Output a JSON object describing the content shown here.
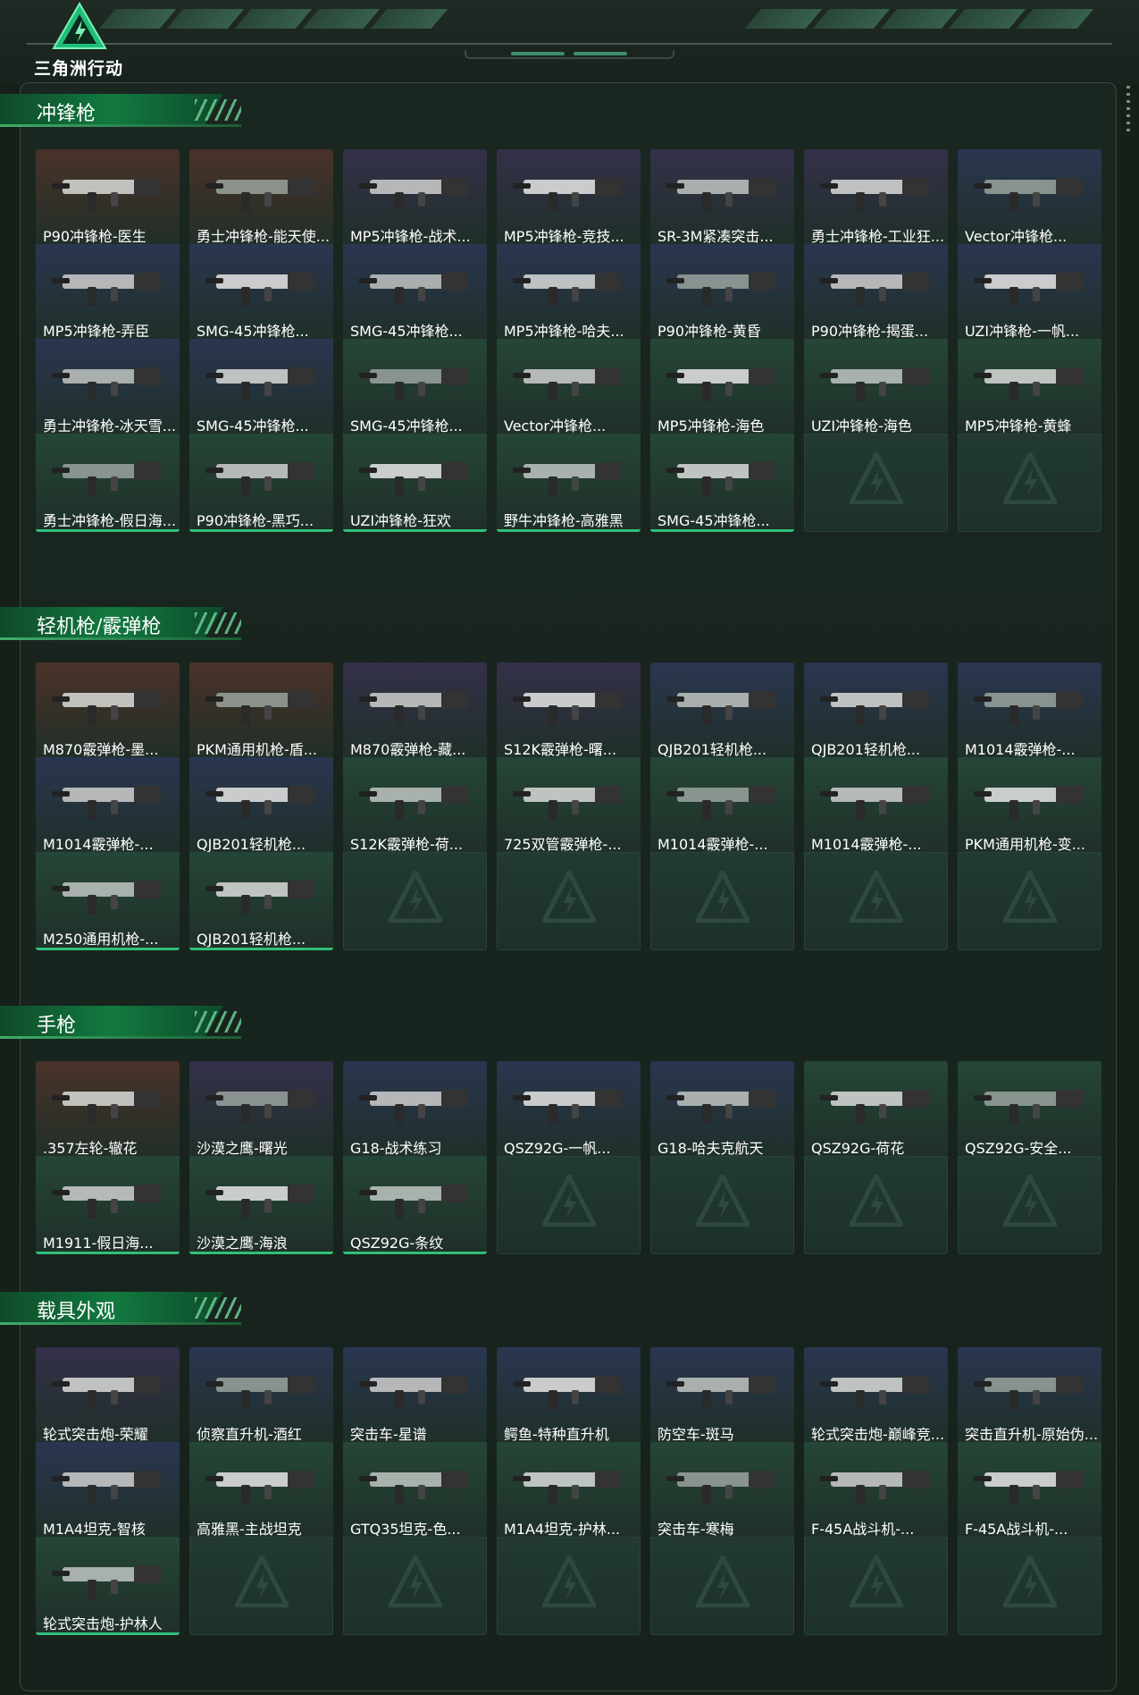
{
  "brand": {
    "logo_text": "三角洲行动"
  },
  "colors": {
    "orange": "#c96a22",
    "purple": "#7a3ed3",
    "blue": "#2d6fd6",
    "green": "#2fc07a",
    "gray": "#8a8f8c",
    "bg_orange": "#4a3229",
    "bg_purple": "#34304a",
    "bg_blue": "#2a3650",
    "bg_green": "#254636"
  },
  "sections": [
    {
      "title": "冲锋枪",
      "items": [
        {
          "name": "P90冲锋枪-医生",
          "rarity": "orange"
        },
        {
          "name": "勇士冲锋枪-能天使...",
          "rarity": "orange"
        },
        {
          "name": "MP5冲锋枪-战术...",
          "rarity": "purple"
        },
        {
          "name": "MP5冲锋枪-竞技...",
          "rarity": "purple"
        },
        {
          "name": "SR-3M紧凑突击...",
          "rarity": "purple"
        },
        {
          "name": "勇士冲锋枪-工业狂...",
          "rarity": "purple"
        },
        {
          "name": "Vector冲锋枪...",
          "rarity": "blue"
        },
        {
          "name": "MP5冲锋枪-弄臣",
          "rarity": "blue"
        },
        {
          "name": "SMG-45冲锋枪...",
          "rarity": "blue"
        },
        {
          "name": "SMG-45冲锋枪...",
          "rarity": "blue"
        },
        {
          "name": "MP5冲锋枪-哈夫...",
          "rarity": "blue"
        },
        {
          "name": "P90冲锋枪-黄昏",
          "rarity": "blue"
        },
        {
          "name": "P90冲锋枪-揭蛋...",
          "rarity": "blue"
        },
        {
          "name": "UZI冲锋枪-一帆...",
          "rarity": "blue"
        },
        {
          "name": "勇士冲锋枪-冰天雪...",
          "rarity": "blue"
        },
        {
          "name": "SMG-45冲锋枪...",
          "rarity": "blue"
        },
        {
          "name": "SMG-45冲锋枪...",
          "rarity": "green"
        },
        {
          "name": "Vector冲锋枪...",
          "rarity": "green"
        },
        {
          "name": "MP5冲锋枪-海色",
          "rarity": "green"
        },
        {
          "name": "UZI冲锋枪-海色",
          "rarity": "green"
        },
        {
          "name": "MP5冲锋枪-黄蜂",
          "rarity": "green"
        },
        {
          "name": "勇士冲锋枪-假日海...",
          "rarity": "green"
        },
        {
          "name": "P90冲锋枪-黑巧...",
          "rarity": "green"
        },
        {
          "name": "UZI冲锋枪-狂欢",
          "rarity": "green"
        },
        {
          "name": "野牛冲锋枪-高雅黑",
          "rarity": "green"
        },
        {
          "name": "SMG-45冲锋枪...",
          "rarity": "green"
        },
        {
          "name": "",
          "rarity": "empty"
        },
        {
          "name": "",
          "rarity": "empty"
        }
      ]
    },
    {
      "title": "轻机枪/霰弹枪",
      "items": [
        {
          "name": "M870霰弹枪-墨...",
          "rarity": "orange"
        },
        {
          "name": "PKM通用机枪-盾...",
          "rarity": "orange"
        },
        {
          "name": "M870霰弹枪-藏...",
          "rarity": "purple"
        },
        {
          "name": "S12K霰弹枪-曙...",
          "rarity": "purple"
        },
        {
          "name": "QJB201轻机枪...",
          "rarity": "blue"
        },
        {
          "name": "QJB201轻机枪...",
          "rarity": "blue"
        },
        {
          "name": "M1014霰弹枪-...",
          "rarity": "blue"
        },
        {
          "name": "M1014霰弹枪-...",
          "rarity": "blue"
        },
        {
          "name": "QJB201轻机枪...",
          "rarity": "blue"
        },
        {
          "name": "S12K霰弹枪-荷...",
          "rarity": "green"
        },
        {
          "name": "725双管霰弹枪-...",
          "rarity": "green"
        },
        {
          "name": "M1014霰弹枪-...",
          "rarity": "green"
        },
        {
          "name": "M1014霰弹枪-...",
          "rarity": "green"
        },
        {
          "name": "PKM通用机枪-变...",
          "rarity": "green"
        },
        {
          "name": "M250通用机枪-...",
          "rarity": "green"
        },
        {
          "name": "QJB201轻机枪...",
          "rarity": "green"
        },
        {
          "name": "",
          "rarity": "empty"
        },
        {
          "name": "",
          "rarity": "empty"
        },
        {
          "name": "",
          "rarity": "empty"
        },
        {
          "name": "",
          "rarity": "empty"
        },
        {
          "name": "",
          "rarity": "empty"
        }
      ]
    },
    {
      "title": "手枪",
      "items": [
        {
          "name": ".357左轮-辙花",
          "rarity": "orange"
        },
        {
          "name": "沙漠之鹰-曙光",
          "rarity": "purple"
        },
        {
          "name": "G18-战术练习",
          "rarity": "blue"
        },
        {
          "name": "QSZ92G-一帆...",
          "rarity": "blue"
        },
        {
          "name": "G18-哈夫克航天",
          "rarity": "blue"
        },
        {
          "name": "QSZ92G-荷花",
          "rarity": "green"
        },
        {
          "name": "QSZ92G-安全...",
          "rarity": "green"
        },
        {
          "name": "M1911-假日海...",
          "rarity": "green"
        },
        {
          "name": "沙漠之鹰-海浪",
          "rarity": "green"
        },
        {
          "name": "QSZ92G-条纹",
          "rarity": "green"
        },
        {
          "name": "",
          "rarity": "empty"
        },
        {
          "name": "",
          "rarity": "empty"
        },
        {
          "name": "",
          "rarity": "empty"
        },
        {
          "name": "",
          "rarity": "empty"
        }
      ]
    },
    {
      "title": "载具外观",
      "items": [
        {
          "name": "轮式突击炮-荣耀",
          "rarity": "purple"
        },
        {
          "name": "侦察直升机-酒红",
          "rarity": "blue"
        },
        {
          "name": "突击车-星谱",
          "rarity": "blue"
        },
        {
          "name": "鳄鱼-特种直升机",
          "rarity": "blue"
        },
        {
          "name": "防空车-斑马",
          "rarity": "blue"
        },
        {
          "name": "轮式突击炮-巅峰竞...",
          "rarity": "blue"
        },
        {
          "name": "突击直升机-原始伪...",
          "rarity": "blue"
        },
        {
          "name": "M1A4坦克-智核",
          "rarity": "blue"
        },
        {
          "name": "高雅黑-主战坦克",
          "rarity": "green"
        },
        {
          "name": "GTQ35坦克-色...",
          "rarity": "green"
        },
        {
          "name": "M1A4坦克-护林...",
          "rarity": "green"
        },
        {
          "name": "突击车-寒梅",
          "rarity": "green"
        },
        {
          "name": "F-45A战斗机-...",
          "rarity": "green"
        },
        {
          "name": "F-45A战斗机-...",
          "rarity": "green"
        },
        {
          "name": "轮式突击炮-护林人",
          "rarity": "green"
        },
        {
          "name": "",
          "rarity": "empty"
        },
        {
          "name": "",
          "rarity": "empty"
        },
        {
          "name": "",
          "rarity": "empty"
        },
        {
          "name": "",
          "rarity": "empty"
        },
        {
          "name": "",
          "rarity": "empty"
        },
        {
          "name": "",
          "rarity": "empty"
        }
      ]
    }
  ]
}
